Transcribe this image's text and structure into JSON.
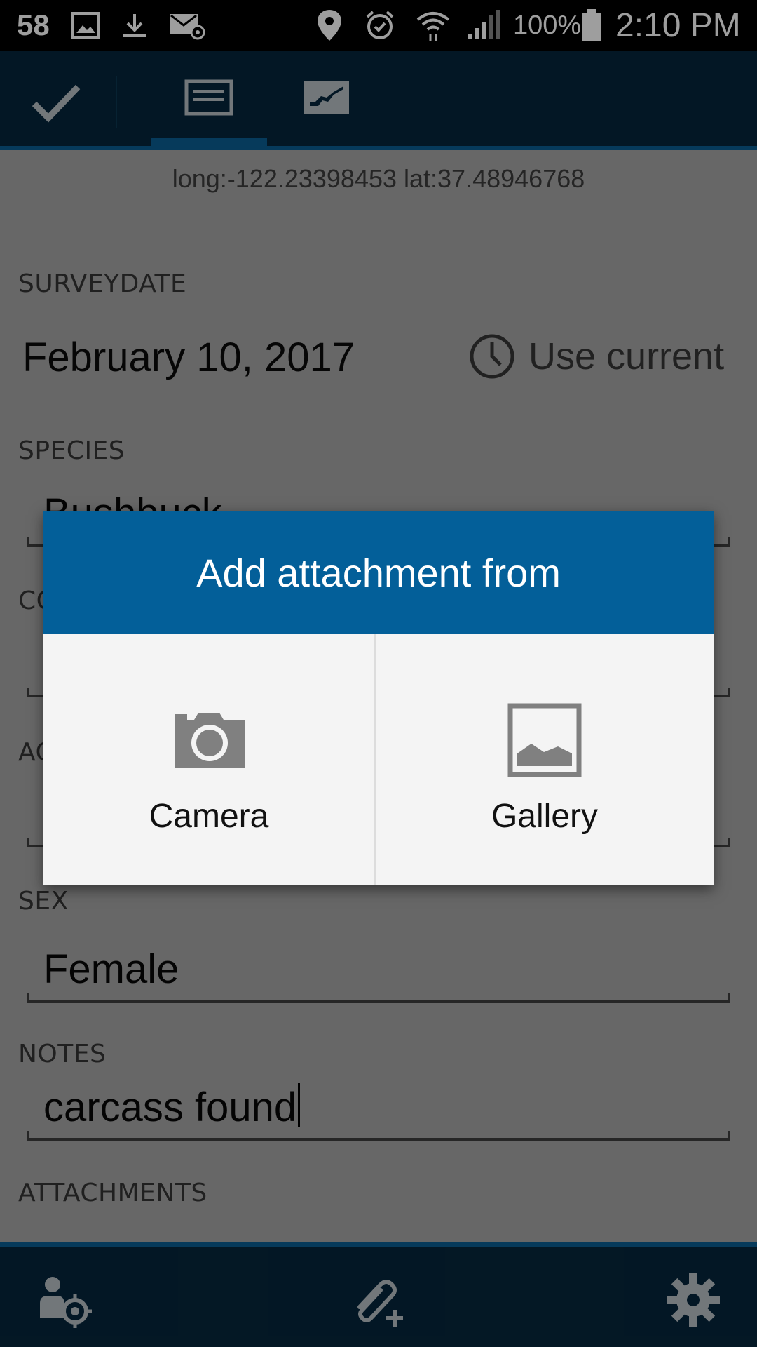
{
  "status_bar": {
    "notification_count": "58",
    "battery_percent": "100%",
    "time": "2:10 PM",
    "icons": [
      "image-icon",
      "download-icon",
      "email-icon",
      "location-icon",
      "alarm-icon",
      "wifi-icon",
      "signal-icon",
      "battery-icon"
    ]
  },
  "top_bar": {
    "icons": [
      "check-icon",
      "form-tab-icon",
      "map-tab-icon"
    ],
    "active_tab": "form"
  },
  "form": {
    "coordinates": "long:-122.23398453 lat:37.48946768",
    "survey_date_label": "SURVEYDATE",
    "survey_date_value": "February 10, 2017",
    "use_current_label": "Use current",
    "species_label": "SPECIES",
    "species_value": "Bushbuck",
    "condition_label": "CO",
    "age_label": "AG",
    "sex_label": "SEX",
    "sex_value": "Female",
    "notes_label": "NOTES",
    "notes_value": "carcass found",
    "attachments_label": "ATTACHMENTS"
  },
  "dialog": {
    "title": "Add attachment from",
    "camera_label": "Camera",
    "gallery_label": "Gallery"
  },
  "bottom_bar": {
    "icons": [
      "user-location-icon",
      "add-attachment-icon",
      "settings-icon"
    ]
  },
  "colors": {
    "bar_bg": "#06263c",
    "accent": "#0a5e93",
    "dialog_header": "#035f99"
  }
}
